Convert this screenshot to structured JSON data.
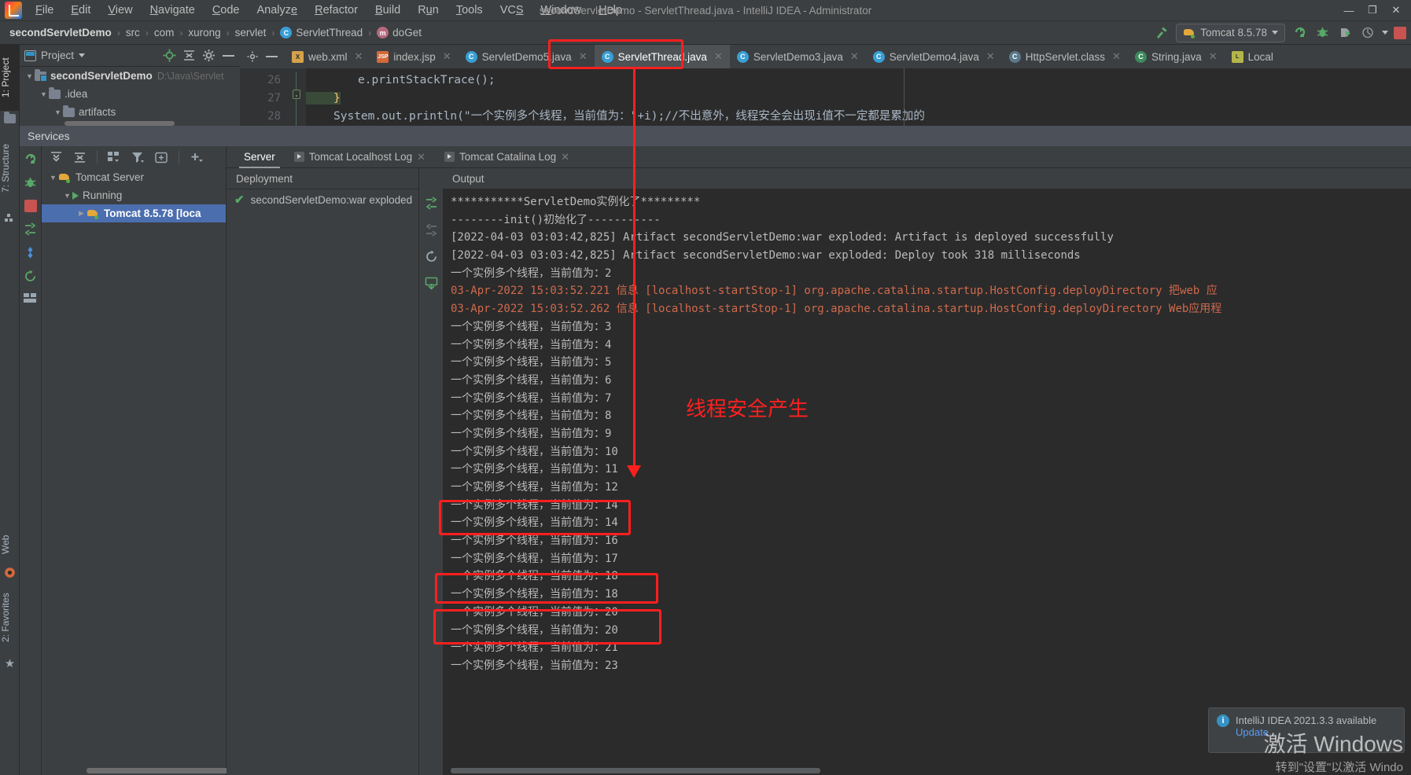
{
  "window": {
    "title": "secondServletDemo - ServletThread.java - IntelliJ IDEA - Administrator",
    "minimize": "—",
    "maximize": "❐",
    "close": "✕"
  },
  "menubar": {
    "items": [
      "File",
      "Edit",
      "View",
      "Navigate",
      "Code",
      "Analyze",
      "Refactor",
      "Build",
      "Run",
      "Tools",
      "VCS",
      "Window",
      "Help"
    ]
  },
  "breadcrumb": {
    "items": [
      "secondServletDemo",
      "src",
      "com",
      "xurong",
      "servlet",
      "ServletThread",
      "doGet"
    ],
    "class_glyph": "C",
    "method_glyph": "m",
    "separator": "›"
  },
  "run_config": {
    "name": "Tomcat 8.5.78",
    "icons": [
      "rerun-icon",
      "debug-icon",
      "run-with-coverage-icon",
      "profiler-icon",
      "stop-icon"
    ]
  },
  "left_strip": {
    "tabs": [
      {
        "label": "1: Project",
        "active": true
      },
      {
        "label": "7: Structure",
        "active": false
      }
    ],
    "bottom_tabs": [
      {
        "label": "Web"
      },
      {
        "label": "2: Favorites"
      }
    ]
  },
  "project_panel": {
    "title": "Project",
    "tree": [
      {
        "label": "secondServletDemo",
        "path": "D:\\Java\\Servlet",
        "depth": 0,
        "bold": true
      },
      {
        "label": ".idea",
        "path": "",
        "depth": 1,
        "bold": false
      },
      {
        "label": "artifacts",
        "path": "",
        "depth": 2,
        "bold": false
      }
    ]
  },
  "editor": {
    "tabs": [
      {
        "label": "web.xml",
        "icon": "xml-file-icon",
        "active": false
      },
      {
        "label": "index.jsp",
        "icon": "jsp-file-icon",
        "active": false
      },
      {
        "label": "ServletDemo5.java",
        "icon": "java-class-icon",
        "active": false
      },
      {
        "label": "ServletThread.java",
        "icon": "java-class-icon",
        "active": true
      },
      {
        "label": "ServletDemo3.java",
        "icon": "java-class-icon",
        "active": false
      },
      {
        "label": "ServletDemo4.java",
        "icon": "java-class-icon",
        "active": false
      },
      {
        "label": "HttpServlet.class",
        "icon": "class-file-icon",
        "active": false
      },
      {
        "label": "String.java",
        "icon": "java-class-icon",
        "active": false
      },
      {
        "label": "Local",
        "icon": "local-file-icon",
        "active": false
      }
    ],
    "lines": [
      {
        "no": "26",
        "text": "e.printStackTrace();"
      },
      {
        "no": "27",
        "text": "}"
      },
      {
        "no": "28",
        "text": "System.out.println(\"一个实例多个线程，当前值为：\"+i);//不出意外，线程安全会出现i值不一定都是累加的"
      }
    ]
  },
  "services": {
    "title": "Services",
    "tree": [
      {
        "label": "Tomcat Server",
        "depth": 0,
        "selected": false,
        "icon": "tomcat-icon"
      },
      {
        "label": "Running",
        "depth": 1,
        "selected": false,
        "icon": "running-icon"
      },
      {
        "label": "Tomcat 8.5.78 [loca",
        "depth": 2,
        "selected": true,
        "icon": "tomcat-icon"
      }
    ],
    "tabs": [
      {
        "label": "Server",
        "active": true,
        "closable": false
      },
      {
        "label": "Tomcat Localhost Log",
        "active": false,
        "closable": true
      },
      {
        "label": "Tomcat Catalina Log",
        "active": false,
        "closable": true
      }
    ],
    "deployment": {
      "header": "Deployment",
      "items": [
        {
          "label": "secondServletDemo:war exploded",
          "status": "ok"
        }
      ]
    },
    "output": {
      "header": "Output",
      "lines": [
        {
          "text": "***********ServletDemo实例化了*********",
          "type": "normal"
        },
        {
          "text": "--------init()初始化了-----------",
          "type": "normal"
        },
        {
          "text": "[2022-04-03 03:03:42,825] Artifact secondServletDemo:war exploded: Artifact is deployed successfully",
          "type": "normal"
        },
        {
          "text": "[2022-04-03 03:03:42,825] Artifact secondServletDemo:war exploded: Deploy took 318 milliseconds",
          "type": "normal"
        },
        {
          "text": "一个实例多个线程，当前值为：2",
          "type": "normal"
        },
        {
          "text": "03-Apr-2022 15:03:52.221 信息 [localhost-startStop-1] org.apache.catalina.startup.HostConfig.deployDirectory 把web 应",
          "type": "error"
        },
        {
          "text": "03-Apr-2022 15:03:52.262 信息 [localhost-startStop-1] org.apache.catalina.startup.HostConfig.deployDirectory Web应用程",
          "type": "error"
        },
        {
          "text": "一个实例多个线程，当前值为：3",
          "type": "normal"
        },
        {
          "text": "一个实例多个线程，当前值为：4",
          "type": "normal"
        },
        {
          "text": "一个实例多个线程，当前值为：5",
          "type": "normal"
        },
        {
          "text": "一个实例多个线程，当前值为：6",
          "type": "normal"
        },
        {
          "text": "一个实例多个线程，当前值为：7",
          "type": "normal"
        },
        {
          "text": "一个实例多个线程，当前值为：8",
          "type": "normal"
        },
        {
          "text": "一个实例多个线程，当前值为：9",
          "type": "normal"
        },
        {
          "text": "一个实例多个线程，当前值为：10",
          "type": "normal"
        },
        {
          "text": "一个实例多个线程，当前值为：11",
          "type": "normal"
        },
        {
          "text": "一个实例多个线程，当前值为：12",
          "type": "normal"
        },
        {
          "text": "一个实例多个线程，当前值为：14",
          "type": "normal"
        },
        {
          "text": "一个实例多个线程，当前值为：14",
          "type": "normal"
        },
        {
          "text": "一个实例多个线程，当前值为：16",
          "type": "normal"
        },
        {
          "text": "一个实例多个线程，当前值为：17",
          "type": "normal"
        },
        {
          "text": "一个实例多个线程，当前值为：18",
          "type": "normal"
        },
        {
          "text": "一个实例多个线程，当前值为：18",
          "type": "normal"
        },
        {
          "text": "一个实例多个线程，当前值为：20",
          "type": "normal"
        },
        {
          "text": "一个实例多个线程，当前值为：20",
          "type": "normal"
        },
        {
          "text": "一个实例多个线程，当前值为：21",
          "type": "normal"
        },
        {
          "text": "一个实例多个线程，当前值为：23",
          "type": "normal"
        }
      ]
    }
  },
  "annotations": {
    "label": "线程安全产生",
    "color": "#ff1f1f"
  },
  "notification": {
    "title": "IntelliJ IDEA 2021.3.3 available",
    "action": "Update..."
  },
  "watermark": {
    "line1": "激活 Windows",
    "line2": "转到\"设置\"以激活 Windo"
  }
}
